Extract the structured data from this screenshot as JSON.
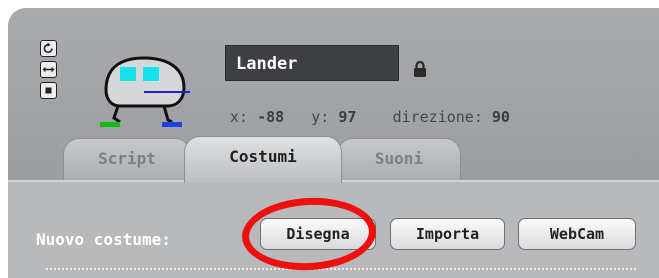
{
  "sprite": {
    "name": "Lander",
    "x_label": "x:",
    "x_value": "-88",
    "y_label": "y:",
    "y_value": "97",
    "direction_label": "direzione:",
    "direction_value": "90"
  },
  "rotation_styles": [
    "rotate-icon",
    "left-right-icon",
    "no-rotate-icon"
  ],
  "tabs": [
    {
      "label": "Script",
      "active": false
    },
    {
      "label": "Costumi",
      "active": true
    },
    {
      "label": "Suoni",
      "active": false
    }
  ],
  "costumes": {
    "new_label": "Nuovo costume:",
    "buttons": {
      "paint": "Disegna",
      "import": "Importa",
      "webcam": "WebCam"
    }
  },
  "colors": {
    "highlight": "#ee0f0f",
    "name_field_bg": "#3d3f42",
    "panel_bg": "#b5b7ba"
  }
}
